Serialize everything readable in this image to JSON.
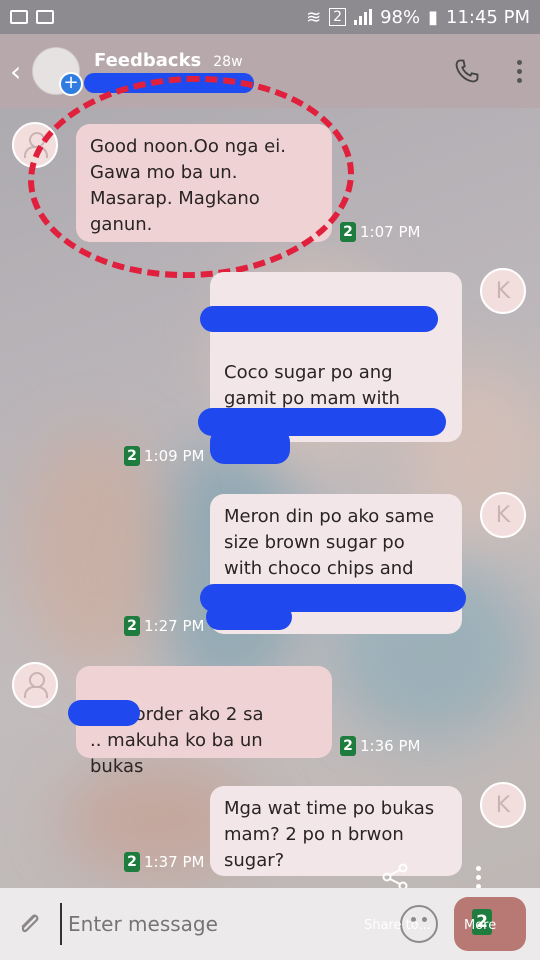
{
  "status_bar": {
    "sim_badge": "2",
    "battery": "98%",
    "time": "11:45 PM"
  },
  "header": {
    "title": "Feedbacks",
    "age": "28w"
  },
  "messages": [
    {
      "dir": "in",
      "avatar": "person",
      "text": "Good noon.Oo nga ei. Gawa mo ba un. Masarap. Magkano ganun.",
      "sim": "2",
      "time": "1:07 PM"
    },
    {
      "dir": "out",
      "avatar": "K",
      "text": "Opo mam gawa ko po\n\nCoco sugar po ang gamit po mam with choco chips and walnuts",
      "sim": "2",
      "time": "1:09 PM"
    },
    {
      "dir": "out",
      "avatar": "K",
      "text": "Meron din po ako same size brown sugar po with choco chips and walnuts",
      "sim": "2",
      "time": "1:27 PM"
    },
    {
      "dir": "in",
      "avatar": "person",
      "text": "Sige order ako 2 sa\n.. makuha ko ba un bukas",
      "sim": "2",
      "time": "1:36 PM"
    },
    {
      "dir": "out",
      "avatar": "K",
      "text": "Mga wat time po bukas mam? 2 po n brwon sugar?",
      "sim": "2",
      "time": "1:37 PM"
    }
  ],
  "composer": {
    "placeholder": "Enter message",
    "share_label": "Share to...",
    "more_label": "More",
    "send_sim": "2"
  },
  "colors": {
    "annotation": "#e0203c",
    "redaction": "#2048ef",
    "sim_badge": "#1e7d3e"
  }
}
